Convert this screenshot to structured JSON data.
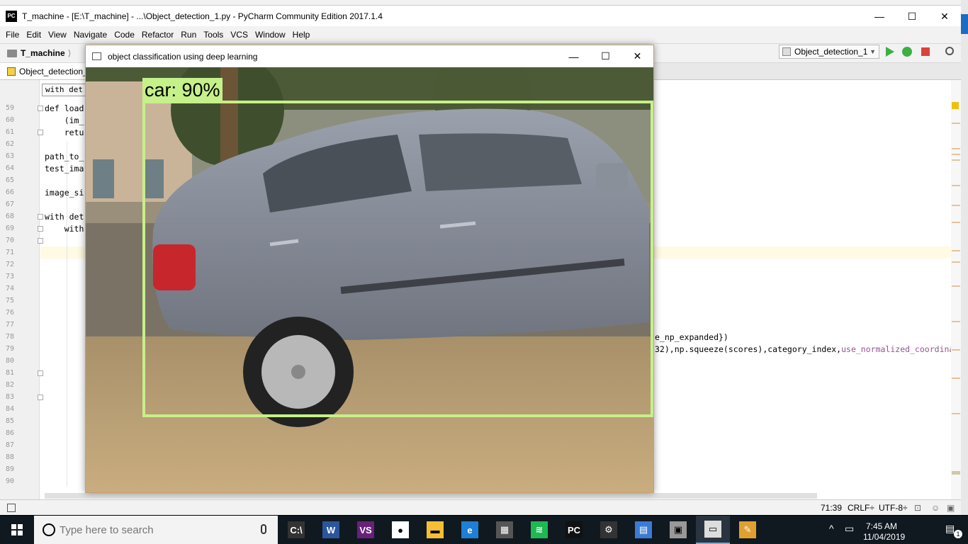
{
  "ide": {
    "title": "T_machine - [E:\\T_machine] - ...\\Object_detection_1.py - PyCharm Community Edition 2017.1.4",
    "app_icon": "PC",
    "window_controls": {
      "minimize": "—",
      "maximize": "☐",
      "close": "✕"
    },
    "menu": [
      "File",
      "Edit",
      "View",
      "Navigate",
      "Code",
      "Refactor",
      "Run",
      "Tools",
      "VCS",
      "Window",
      "Help"
    ],
    "nav": {
      "project": "T_machine",
      "chevron": "⟩"
    },
    "run_config": "Object_detection_1",
    "tab": "Object_detection_",
    "breadcrumb_hint": "with det",
    "line_numbers": [
      "59",
      "60",
      "61",
      "62",
      "63",
      "64",
      "65",
      "66",
      "67",
      "68",
      "69",
      "70",
      "71",
      "72",
      "73",
      "74",
      "75",
      "76",
      "77",
      "78",
      "79",
      "80",
      "81",
      "82",
      "83",
      "84",
      "85",
      "86",
      "87",
      "88",
      "89",
      "90"
    ],
    "code_lines": {
      "l59": "def load",
      "l60": "    (im_",
      "l61": "    retu",
      "l63": "path_to_",
      "l64": "test_ima",
      "l66": "image_si",
      "l68": "with det",
      "l69": "    with",
      "l78": "e_np_expanded})",
      "l79_a": "32),np.squeeze(scores),category_index,",
      "l79_b": "use_normalized_coordina"
    },
    "status": {
      "position": "71:39",
      "line_sep": "CRLF÷",
      "encoding": "UTF-8÷"
    }
  },
  "cv_window": {
    "title": "object classification using deep learning",
    "window_controls": {
      "minimize": "—",
      "maximize": "☐",
      "close": "✕"
    },
    "detection": {
      "label": "car: 90%",
      "color": "#c6f089"
    }
  },
  "taskbar": {
    "search_placeholder": "Type here to search",
    "apps": [
      {
        "name": "cmd-icon",
        "glyph": "C:\\"
      },
      {
        "name": "word-icon",
        "glyph": "W"
      },
      {
        "name": "visual-studio-icon",
        "glyph": "VS"
      },
      {
        "name": "chrome-icon",
        "glyph": "●"
      },
      {
        "name": "file-explorer-icon",
        "glyph": "▬"
      },
      {
        "name": "edge-icon",
        "glyph": "e"
      },
      {
        "name": "store-icon",
        "glyph": "▦"
      },
      {
        "name": "spotify-icon",
        "glyph": "≋"
      },
      {
        "name": "pycharm-icon",
        "glyph": "PC"
      },
      {
        "name": "settings-icon",
        "glyph": "⚙"
      },
      {
        "name": "app-icon-11",
        "glyph": "▤"
      },
      {
        "name": "app-icon-12",
        "glyph": "▣"
      },
      {
        "name": "app-icon-13",
        "glyph": "▭"
      },
      {
        "name": "paint-icon",
        "glyph": "✎"
      }
    ],
    "time": "7:45 AM",
    "date": "11/04/2019",
    "notification_count": "1"
  }
}
